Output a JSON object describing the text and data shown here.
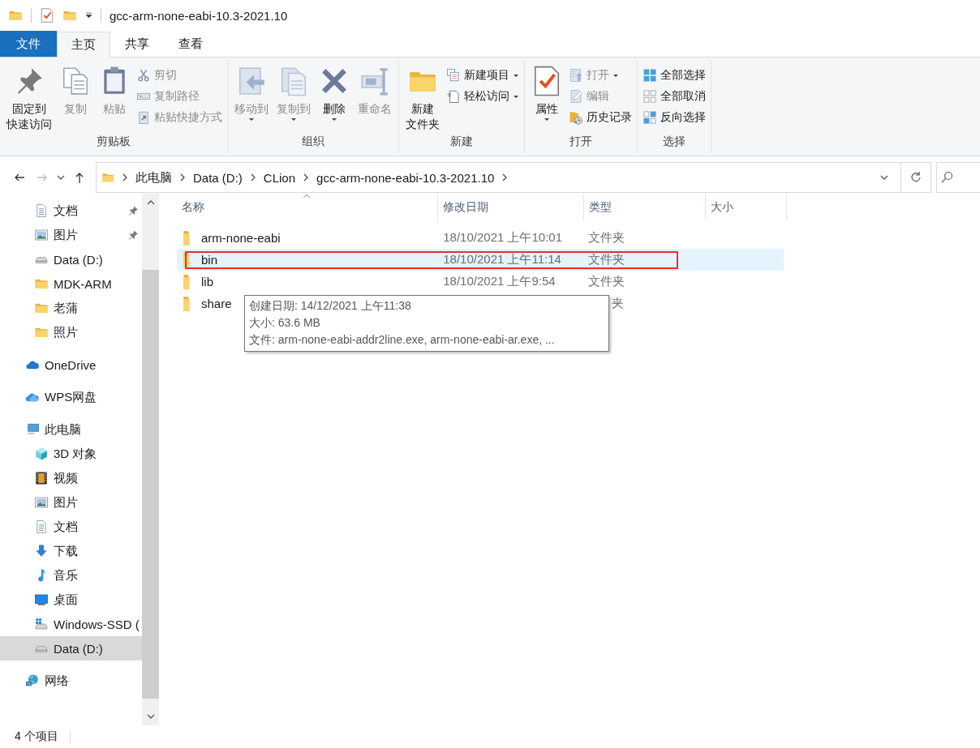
{
  "window": {
    "title": "gcc-arm-none-eabi-10.3-2021.10"
  },
  "tabs": [
    {
      "label": "文件",
      "kind": "file",
      "selected": false
    },
    {
      "label": "主页",
      "kind": "tab",
      "selected": true
    },
    {
      "label": "共享",
      "kind": "tab",
      "selected": false
    },
    {
      "label": "查看",
      "kind": "tab",
      "selected": false
    }
  ],
  "ribbon": {
    "groups": [
      {
        "label": "剪贴板",
        "large_buttons": [
          {
            "label_lines": [
              "固定到",
              "快速访问"
            ],
            "kind": "pin",
            "disabled": false,
            "menu": false
          },
          {
            "label": "复制",
            "kind": "copy",
            "disabled": true,
            "menu": false
          },
          {
            "label": "粘贴",
            "kind": "paste",
            "disabled": true,
            "menu": false
          }
        ],
        "small_buttons": [
          {
            "label": "剪切",
            "kind": "cut",
            "disabled": true,
            "menu": false
          },
          {
            "label": "复制路径",
            "kind": "copypath",
            "disabled": true,
            "menu": false
          },
          {
            "label": "粘贴快捷方式",
            "kind": "shortcut",
            "disabled": true,
            "menu": false
          }
        ]
      },
      {
        "label": "组织",
        "large_buttons": [
          {
            "label": "移动到",
            "kind": "move",
            "disabled": true,
            "menu": true
          },
          {
            "label": "复制到",
            "kind": "copyto",
            "disabled": true,
            "menu": true
          },
          {
            "label": "删除",
            "kind": "delete",
            "disabled": false,
            "menu": true
          },
          {
            "label": "重命名",
            "kind": "rename",
            "disabled": true,
            "menu": false
          }
        ]
      },
      {
        "label": "新建",
        "large_buttons": [
          {
            "label_lines": [
              "新建",
              "文件夹"
            ],
            "kind": "newfolder",
            "disabled": false,
            "menu": false
          }
        ],
        "small_buttons": [
          {
            "label": "新建项目",
            "kind": "newitem",
            "disabled": false,
            "menu": true
          },
          {
            "label": "轻松访问",
            "kind": "easyaccess",
            "disabled": false,
            "menu": true
          }
        ]
      },
      {
        "label": "打开",
        "large_buttons": [
          {
            "label": "属性",
            "kind": "properties",
            "disabled": false,
            "menu": true
          }
        ],
        "small_buttons": [
          {
            "label": "打开",
            "kind": "open",
            "disabled": true,
            "menu": true
          },
          {
            "label": "编辑",
            "kind": "edit",
            "disabled": true,
            "menu": false
          },
          {
            "label": "历史记录",
            "kind": "history",
            "disabled": false,
            "menu": false
          }
        ]
      },
      {
        "label": "选择",
        "small_buttons": [
          {
            "label": "全部选择",
            "kind": "selectall",
            "disabled": false,
            "menu": false
          },
          {
            "label": "全部取消",
            "kind": "selectnone",
            "disabled": false,
            "menu": false
          },
          {
            "label": "反向选择",
            "kind": "invert",
            "disabled": false,
            "menu": false
          }
        ]
      }
    ]
  },
  "navigation": {
    "back_disabled": false,
    "forward_disabled": true
  },
  "address_bar": {
    "crumbs": [
      "此电脑",
      "Data (D:)",
      "CLion",
      "gcc-arm-none-eabi-10.3-2021.10"
    ]
  },
  "sidebar": {
    "quick_access": [
      {
        "label": "文档",
        "kind": "documents",
        "pinned": true,
        "selected": false
      },
      {
        "label": "图片",
        "kind": "pictures",
        "pinned": true,
        "selected": false
      },
      {
        "label": "Data (D:)",
        "kind": "drive",
        "pinned": false,
        "selected": false
      },
      {
        "label": "MDK-ARM",
        "kind": "folder",
        "pinned": false,
        "selected": false
      },
      {
        "label": "老蒲",
        "kind": "folder",
        "pinned": false,
        "selected": false
      },
      {
        "label": "照片",
        "kind": "folder",
        "pinned": false,
        "selected": false
      }
    ],
    "locations": [
      {
        "label": "OneDrive",
        "kind": "onedrive",
        "selected": false
      },
      {
        "label": "WPS网盘",
        "kind": "wps",
        "selected": false
      },
      {
        "label": "此电脑",
        "kind": "pc",
        "selected": false,
        "children": [
          {
            "label": "3D 对象",
            "kind": "objects3d",
            "selected": false
          },
          {
            "label": "视频",
            "kind": "videos",
            "selected": false
          },
          {
            "label": "图片",
            "kind": "pictures",
            "selected": false
          },
          {
            "label": "文档",
            "kind": "documents",
            "selected": false
          },
          {
            "label": "下载",
            "kind": "downloads",
            "selected": false
          },
          {
            "label": "音乐",
            "kind": "music",
            "selected": false
          },
          {
            "label": "桌面",
            "kind": "desktop",
            "selected": false
          },
          {
            "label": "Windows-SSD (",
            "kind": "windowsdrive",
            "selected": false
          },
          {
            "label": "Data (D:)",
            "kind": "drive",
            "selected": true
          }
        ]
      },
      {
        "label": "网络",
        "kind": "network",
        "selected": false
      }
    ]
  },
  "table": {
    "columns": [
      {
        "label": "名称",
        "sorted": true
      },
      {
        "label": "修改日期",
        "sorted": false
      },
      {
        "label": "类型",
        "sorted": false
      },
      {
        "label": "大小",
        "sorted": false
      }
    ],
    "rows": [
      {
        "name": "arm-none-eabi",
        "modified": "18/10/2021 上午10:01",
        "type": "文件夹",
        "hovered": false,
        "annotated": false
      },
      {
        "name": "bin",
        "modified": "18/10/2021 上午11:14",
        "type": "文件夹",
        "hovered": true,
        "annotated": true
      },
      {
        "name": "lib",
        "modified": "18/10/2021 上午9:54",
        "type": "文件夹",
        "hovered": false,
        "annotated": false
      },
      {
        "name": "share",
        "type": "夹",
        "hovered": false,
        "annotated": false,
        "type_covered": true
      }
    ]
  },
  "tooltip": {
    "lines": [
      "创建日期: 14/12/2021 上午11:38",
      "大小: 63.6 MB",
      "文件: arm-none-eabi-addr2line.exe, arm-none-eabi-ar.exe, ..."
    ]
  },
  "status_bar": {
    "text": "4 个项目"
  }
}
